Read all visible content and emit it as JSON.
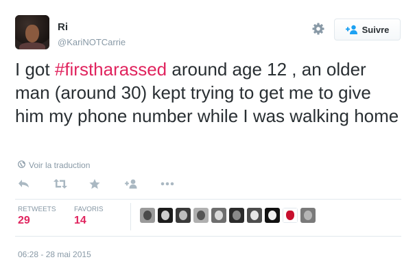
{
  "user": {
    "name": "Ri",
    "handle": "@KariNOTCarrie"
  },
  "follow_button": {
    "label": "Suivre",
    "icon": "add-user-icon"
  },
  "settings_icon": "gear-icon",
  "tweet": {
    "text_before": "I got ",
    "hashtag": "#firstharassed",
    "text_after": " around age 12 , an older man (around 30) kept trying to get me to give him my phone number while I was walking home",
    "translate_label": "Voir la traduction",
    "timestamp": "06:28 - 28 mai 2015"
  },
  "actions": [
    {
      "name": "reply",
      "icon": "reply-icon"
    },
    {
      "name": "retweet",
      "icon": "retweet-icon"
    },
    {
      "name": "favorite",
      "icon": "star-icon"
    },
    {
      "name": "follow",
      "icon": "add-user-icon"
    },
    {
      "name": "more",
      "icon": "more-icon"
    }
  ],
  "stats": {
    "retweets_label": "RETWEETS",
    "retweets_count": "29",
    "favorites_label": "FAVORIS",
    "favorites_count": "14"
  },
  "colors": {
    "accent": "#e0245e",
    "muted": "#8899a6",
    "text": "#292f33"
  }
}
